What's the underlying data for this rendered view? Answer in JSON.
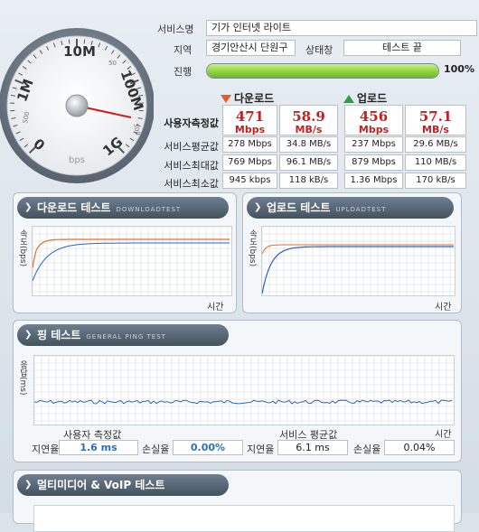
{
  "info": {
    "service_label": "서비스명",
    "service_value": "기가 인터넷 라이트",
    "region_label": "지역",
    "region_value": "경기안산시 단원구",
    "status_label": "상태창",
    "status_value": "테스트 끝",
    "progress_label": "진행",
    "progress_pct": 100,
    "progress_text": "100%"
  },
  "gauge": {
    "ticks": [
      "1M",
      "10M",
      "100M",
      "1G",
      "0"
    ],
    "minor": [
      "50",
      "500",
      "500"
    ],
    "unit": "bps",
    "needle_value": "100M"
  },
  "results": {
    "download_header": "다운로드",
    "upload_header": "업로드",
    "user_measured_label": "사용자측정값",
    "dl_mbps": "471",
    "dl_mbps_unit": "Mbps",
    "dl_mbs": "58.9",
    "dl_mbs_unit": "MB/s",
    "ul_mbps": "456",
    "ul_mbps_unit": "Mbps",
    "ul_mbs": "57.1",
    "ul_mbs_unit": "MB/s",
    "rows": [
      {
        "label": "서비스평균값",
        "dl1": "278 Mbps",
        "dl2": "34.8 MB/s",
        "ul1": "237 Mbps",
        "ul2": "29.6 MB/s"
      },
      {
        "label": "서비스최대값",
        "dl1": "769 Mbps",
        "dl2": "96.1 MB/s",
        "ul1": "879 Mbps",
        "ul2": "110 MB/s"
      },
      {
        "label": "서비스최소값",
        "dl1": "945 kbps",
        "dl2": "118 kB/s",
        "ul1": "1.36 Mbps",
        "ul2": "170 kB/s"
      }
    ]
  },
  "download_test": {
    "title": "다운로드 테스트",
    "subtitle": "DOWNLOADTEST",
    "ylabel": "속도(bps)",
    "xlabel": "시간"
  },
  "upload_test": {
    "title": "업로드 테스트",
    "subtitle": "UPLOADTEST",
    "ylabel": "속도(bps)",
    "xlabel": "시간"
  },
  "ping_test": {
    "title": "핑 테스트",
    "subtitle": "GENERAL PING TEST",
    "ylabel": "응답(ms)",
    "xlabel": "시간",
    "user_header": "사용자 측정값",
    "service_header": "서비스 평균값",
    "latency_label": "지연율",
    "loss_label": "손실율",
    "user_latency": "1.6 ms",
    "user_loss": "0.00%",
    "svc_latency": "6.1 ms",
    "svc_loss": "0.04%"
  },
  "multimedia_test": {
    "title": "멀티미디어 & VoIP 테스트"
  },
  "colors": {
    "download_line": "#e0702a",
    "upload_line": "#2a5fd0",
    "ping_line": "#2a5fd0",
    "progress": "#8fd43a"
  }
}
